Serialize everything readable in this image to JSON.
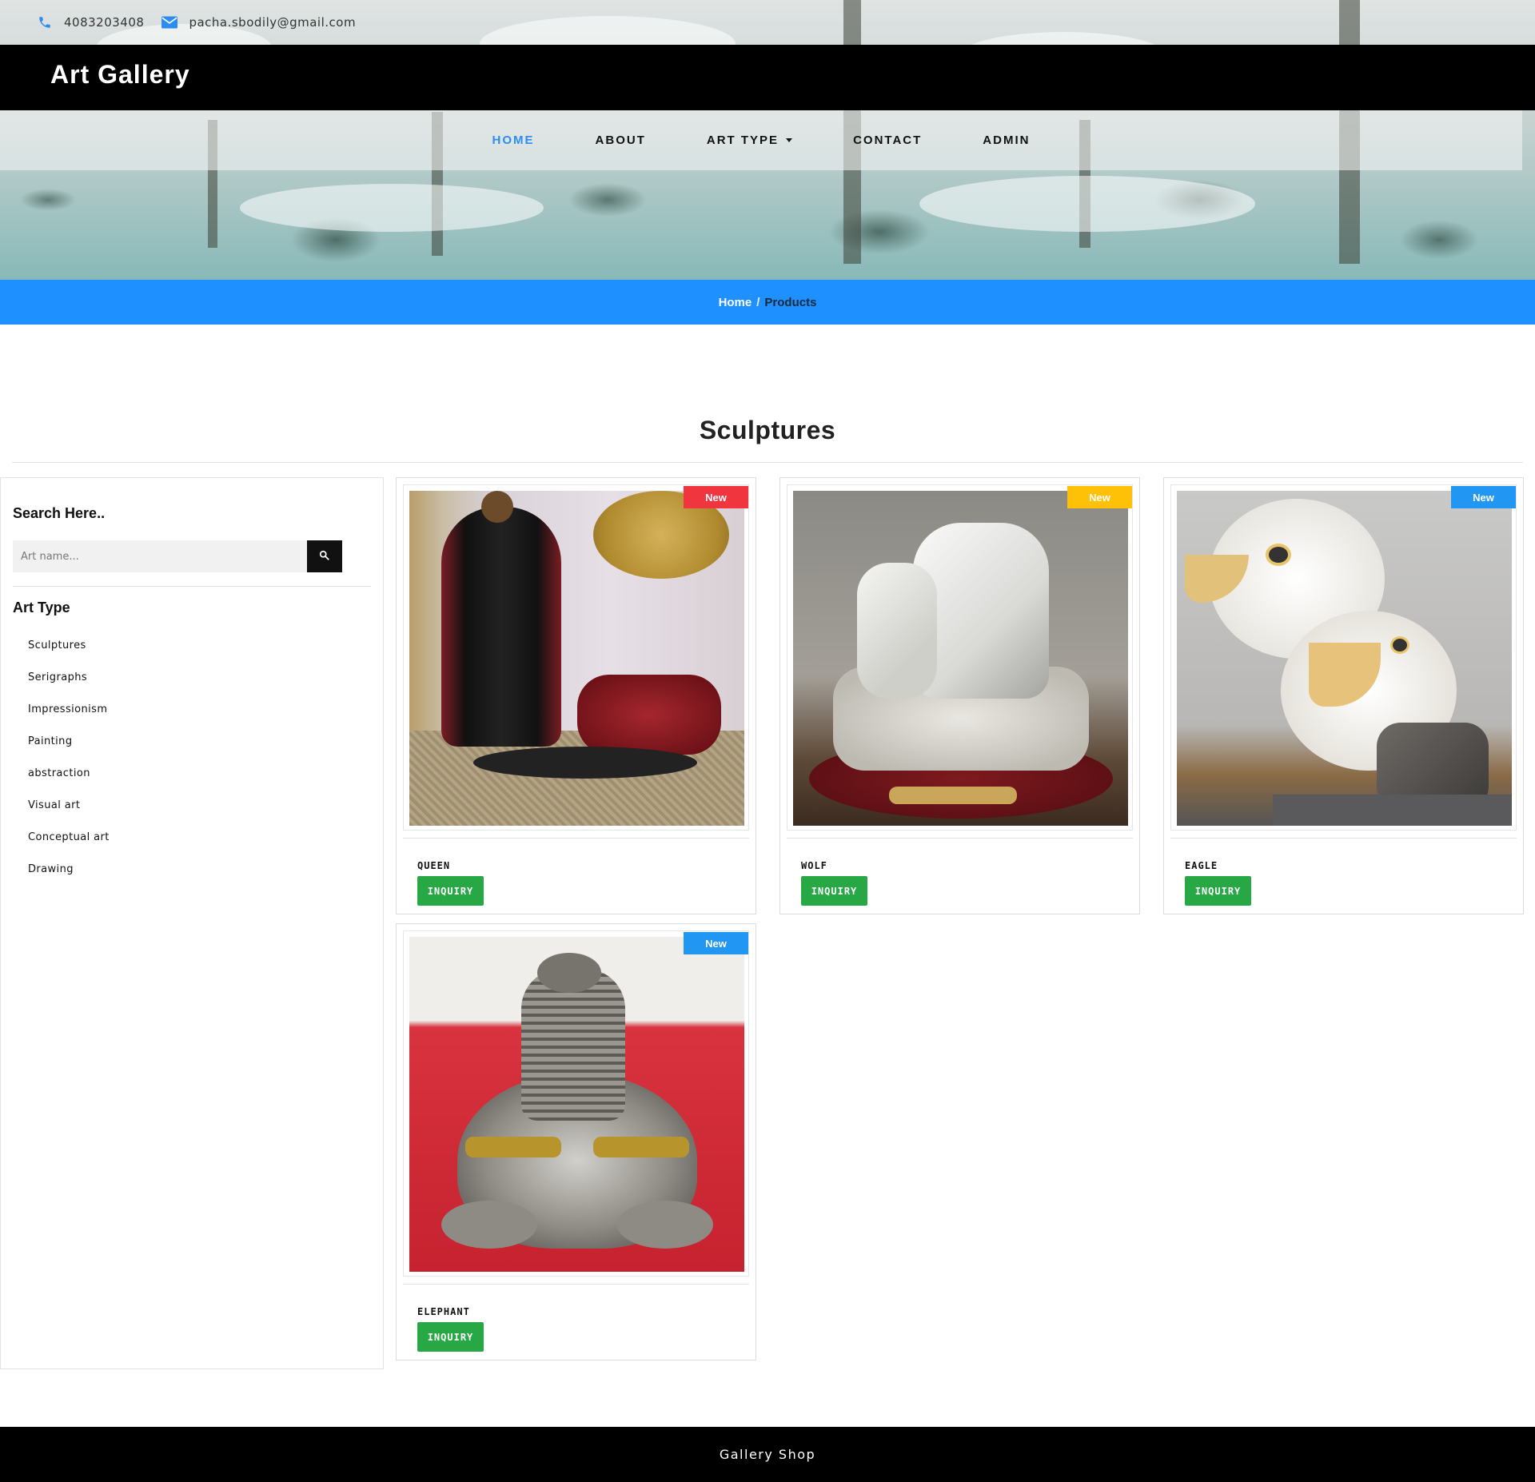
{
  "contact": {
    "phone": "4083203408",
    "email": "pacha.sbodily@gmail.com"
  },
  "brand": {
    "title": "Art Gallery"
  },
  "nav": {
    "items": [
      {
        "label": "HOME",
        "active": true
      },
      {
        "label": "ABOUT",
        "active": false
      },
      {
        "label": "ART TYPE",
        "active": false,
        "dropdown": true
      },
      {
        "label": "CONTACT",
        "active": false
      },
      {
        "label": "ADMIN",
        "active": false
      }
    ]
  },
  "breadcrumb": {
    "home": "Home",
    "separator": "/",
    "current": "Products"
  },
  "section": {
    "title": "Sculptures"
  },
  "sidebar": {
    "search_title": "Search Here..",
    "search_placeholder": "Art name...",
    "art_type_title": "Art Type",
    "art_types": [
      "Sculptures",
      "Serigraphs",
      "Impressionism",
      "Painting",
      "abstraction",
      "Visual art",
      "Conceptual art",
      "Drawing"
    ]
  },
  "products": [
    {
      "name": "QUEEN",
      "badge": "New",
      "badge_color": "#f0353f",
      "button": "INQUIRY"
    },
    {
      "name": "WOLF",
      "badge": "New",
      "badge_color": "#ffc107",
      "button": "INQUIRY"
    },
    {
      "name": "EAGLE",
      "badge": "New",
      "badge_color": "#2196f3",
      "button": "INQUIRY"
    },
    {
      "name": "ELEPHANT",
      "badge": "New",
      "badge_color": "#2196f3",
      "button": "INQUIRY"
    }
  ],
  "footer": {
    "text": "Gallery Shop"
  },
  "colors": {
    "accent": "#1e90ff",
    "nav_active": "#2d8cf0",
    "button_green": "#28a745",
    "header_bg": "#000000"
  },
  "icons": {
    "phone": "phone-icon",
    "email": "envelope-icon",
    "search": "search-icon",
    "dropdown": "caret-down-icon"
  }
}
